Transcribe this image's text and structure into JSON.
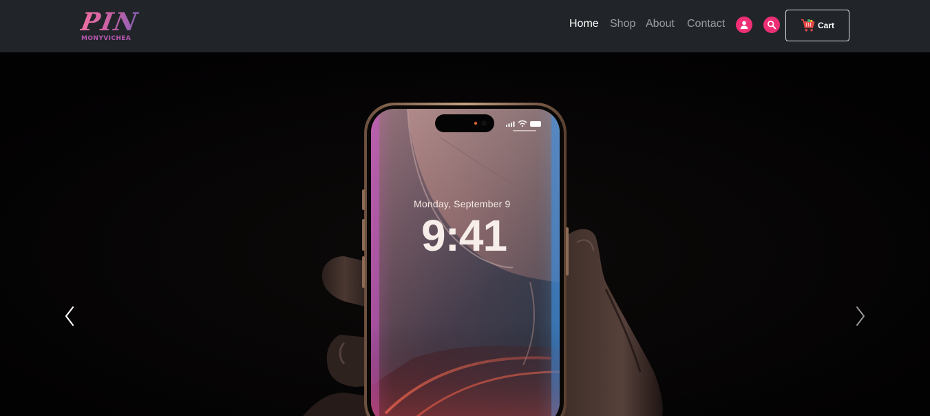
{
  "brand": {
    "logo_text": "PIN",
    "logo_subtext": "MONYVICHEA"
  },
  "nav": {
    "links": [
      {
        "label": "Home",
        "active": true
      },
      {
        "label": "Shop",
        "active": false
      },
      {
        "label": "About",
        "active": false
      },
      {
        "label": "Contact",
        "active": false
      }
    ],
    "user_icon": "user-icon",
    "search_icon": "search-icon",
    "cart": {
      "label": "Cart",
      "icon": "shopping-cart-icon"
    }
  },
  "hero": {
    "lock_screen_date": "Monday, September 9",
    "lock_screen_time": "9:41",
    "prev_icon": "chevron-left-icon",
    "next_icon": "chevron-right-icon"
  },
  "colors": {
    "navbar_bg": "#212529",
    "accent_pink": "#ee2f76",
    "hero_bg": "#050304"
  }
}
